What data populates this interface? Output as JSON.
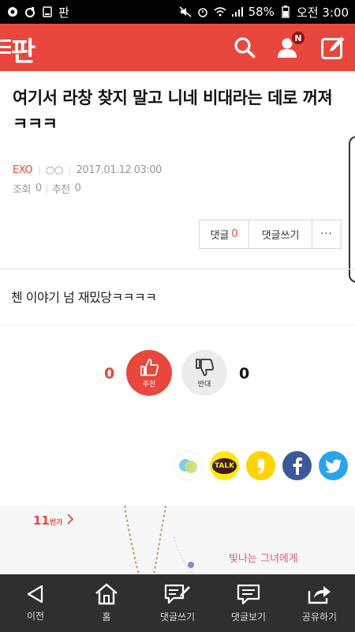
{
  "status_bar": {
    "battery": "58%",
    "time": "오전 3:00",
    "app_icon_text": "판"
  },
  "header": {
    "logo": "판",
    "notification_badge": "N"
  },
  "post": {
    "title": "여기서 라창 찾지 말고 니네 비대라는 데로 꺼져ㅋㅋㅋ",
    "category": "EXO",
    "author": "○○",
    "date": "2017.01.12 03:00",
    "views_label": "조회",
    "views": "0",
    "recommend_label": "추천",
    "recommend": "0",
    "body": "첸 이야기 넘 재밌당ㅋㅋㅋㅋ"
  },
  "comment_bar": {
    "comments_label": "댓글",
    "comments_count": "0",
    "write_label": "댓글쓰기",
    "more": "···"
  },
  "vote": {
    "up_count": "0",
    "up_label": "추천",
    "down_label": "반대",
    "down_count": "0"
  },
  "share": {
    "kakaotalk_label": "TALK"
  },
  "ad": {
    "logo": "11",
    "logo_sub": "번가",
    "line1": "빛나는 그녀에게"
  },
  "bottom_nav": [
    {
      "label": "이전"
    },
    {
      "label": "홈"
    },
    {
      "label": "댓글쓰기"
    },
    {
      "label": "댓글보기"
    },
    {
      "label": "공유하기"
    }
  ],
  "colors": {
    "brand": "#e8473e",
    "nav_bg": "#2f2f31"
  }
}
